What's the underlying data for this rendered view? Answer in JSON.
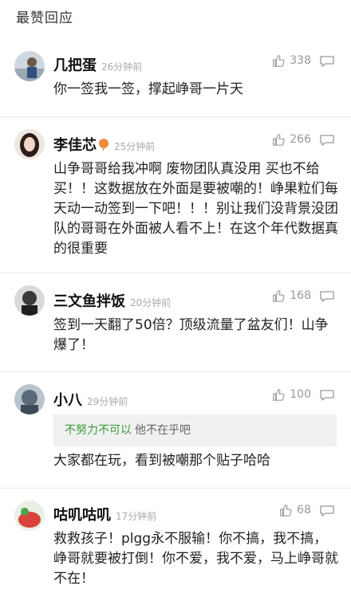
{
  "section": {
    "title": "最赞回应"
  },
  "comments": [
    {
      "name": "几把蛋",
      "time": "26分钟前",
      "likes": "338",
      "text": "你一签我一签，撑起峥哥一片天"
    },
    {
      "name": "李佳芯",
      "time": "25分钟前",
      "likes": "266",
      "text": "山争哥哥给我冲啊 废物团队真没用 买也不给买！！这数据放在外面是要被嘲的！峥果粒们每天动一动签到一下吧！！！别让我们没背景没团队的哥哥在外面被人看不上！在这个年代数据真的很重要"
    },
    {
      "name": "三文鱼拌饭",
      "time": "20分钟前",
      "likes": "168",
      "text": "签到一天翻了50倍？顶级流量了盆友们！山争爆了！"
    },
    {
      "name": "小八",
      "time": "29分钟前",
      "likes": "100",
      "quote_user": "不努力不可以",
      "quote_text": "他不在乎吧",
      "text": "大家都在玩，看到被嘲那个贴子哈哈"
    },
    {
      "name": "咕叽咕叽",
      "time": "17分钟前",
      "likes": "68",
      "text": "救救孩子！plgg永不服输！你不搞，我不搞，峥哥就要被打倒！你不爱，我不爱，马上峥哥就不在！"
    }
  ],
  "colors": {
    "accent_green": "#3a9a3a",
    "muted": "#999999",
    "divider": "#e9e9e9"
  }
}
